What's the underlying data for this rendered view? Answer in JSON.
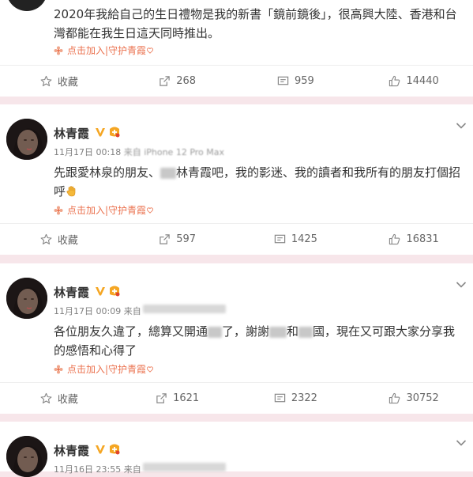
{
  "posts": [
    {
      "text": "2020年我給自己的生日禮物是我的新書「鏡前鏡後」，很高興大陸、香港和台灣都能在我生日這天同時推出。",
      "fan_label": "点击加入|守护青霞",
      "actions": {
        "favorite": "收藏",
        "repost": "268",
        "comment": "959",
        "like": "14440"
      }
    },
    {
      "username": "林青霞",
      "time": "11月17日 00:18",
      "source": "来自 iPhone 12 Pro Max",
      "text_a": "先跟愛林泉的朋友、",
      "text_b": "林青霞吧，我的影迷、我的讀者和我所有的朋友打個招呼",
      "fan_label": "点击加入|守护青霞",
      "actions": {
        "favorite": "收藏",
        "repost": "597",
        "comment": "1425",
        "like": "16831"
      }
    },
    {
      "username": "林青霞",
      "time": "11月17日 00:09",
      "source": "来自",
      "text_a": "各位朋友久違了，總算又開通",
      "text_b": "了，謝謝",
      "text_c": "和",
      "text_d": "國，現在又可跟大家分享我的感悟和心得了",
      "fan_label": "点击加入|守护青霞",
      "actions": {
        "favorite": "收藏",
        "repost": "1621",
        "comment": "2322",
        "like": "30752"
      }
    },
    {
      "username": "林青霞",
      "time": "11月16日 23:55",
      "source": "来自"
    }
  ],
  "colors": {
    "accent": "#eb7350",
    "verified": "#f5a623",
    "page_bg": "#f7e6ea"
  },
  "icons": [
    "star-icon",
    "repost-icon",
    "comment-icon",
    "like-icon",
    "flower-icon",
    "chevron-down-icon",
    "verified-v-icon",
    "fan-badge-icon",
    "hand-wave-icon"
  ]
}
